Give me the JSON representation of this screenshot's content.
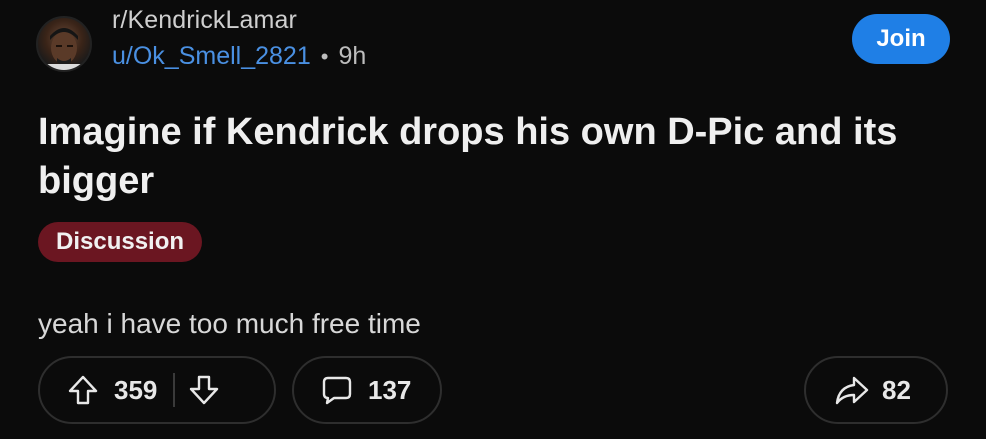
{
  "post": {
    "subreddit": "r/KendrickLamar",
    "author": "u/Ok_Smell_2821",
    "separator": "•",
    "age": "9h",
    "join_label": "Join",
    "title": "Imagine if Kendrick drops his own D-Pic and its bigger",
    "flair": "Discussion",
    "body": "yeah i have too much free time"
  },
  "actions": {
    "upvotes": "359",
    "comments": "137",
    "shares": "82"
  },
  "icons": {
    "upvote": "arrow-up-outline-icon",
    "downvote": "arrow-down-outline-icon",
    "comment": "speech-bubble-icon",
    "share": "share-arrow-icon"
  },
  "colors": {
    "background": "#0b0b0b",
    "join_button": "#1f7fe6",
    "username": "#4a90e2",
    "flair": "#6b1621"
  }
}
